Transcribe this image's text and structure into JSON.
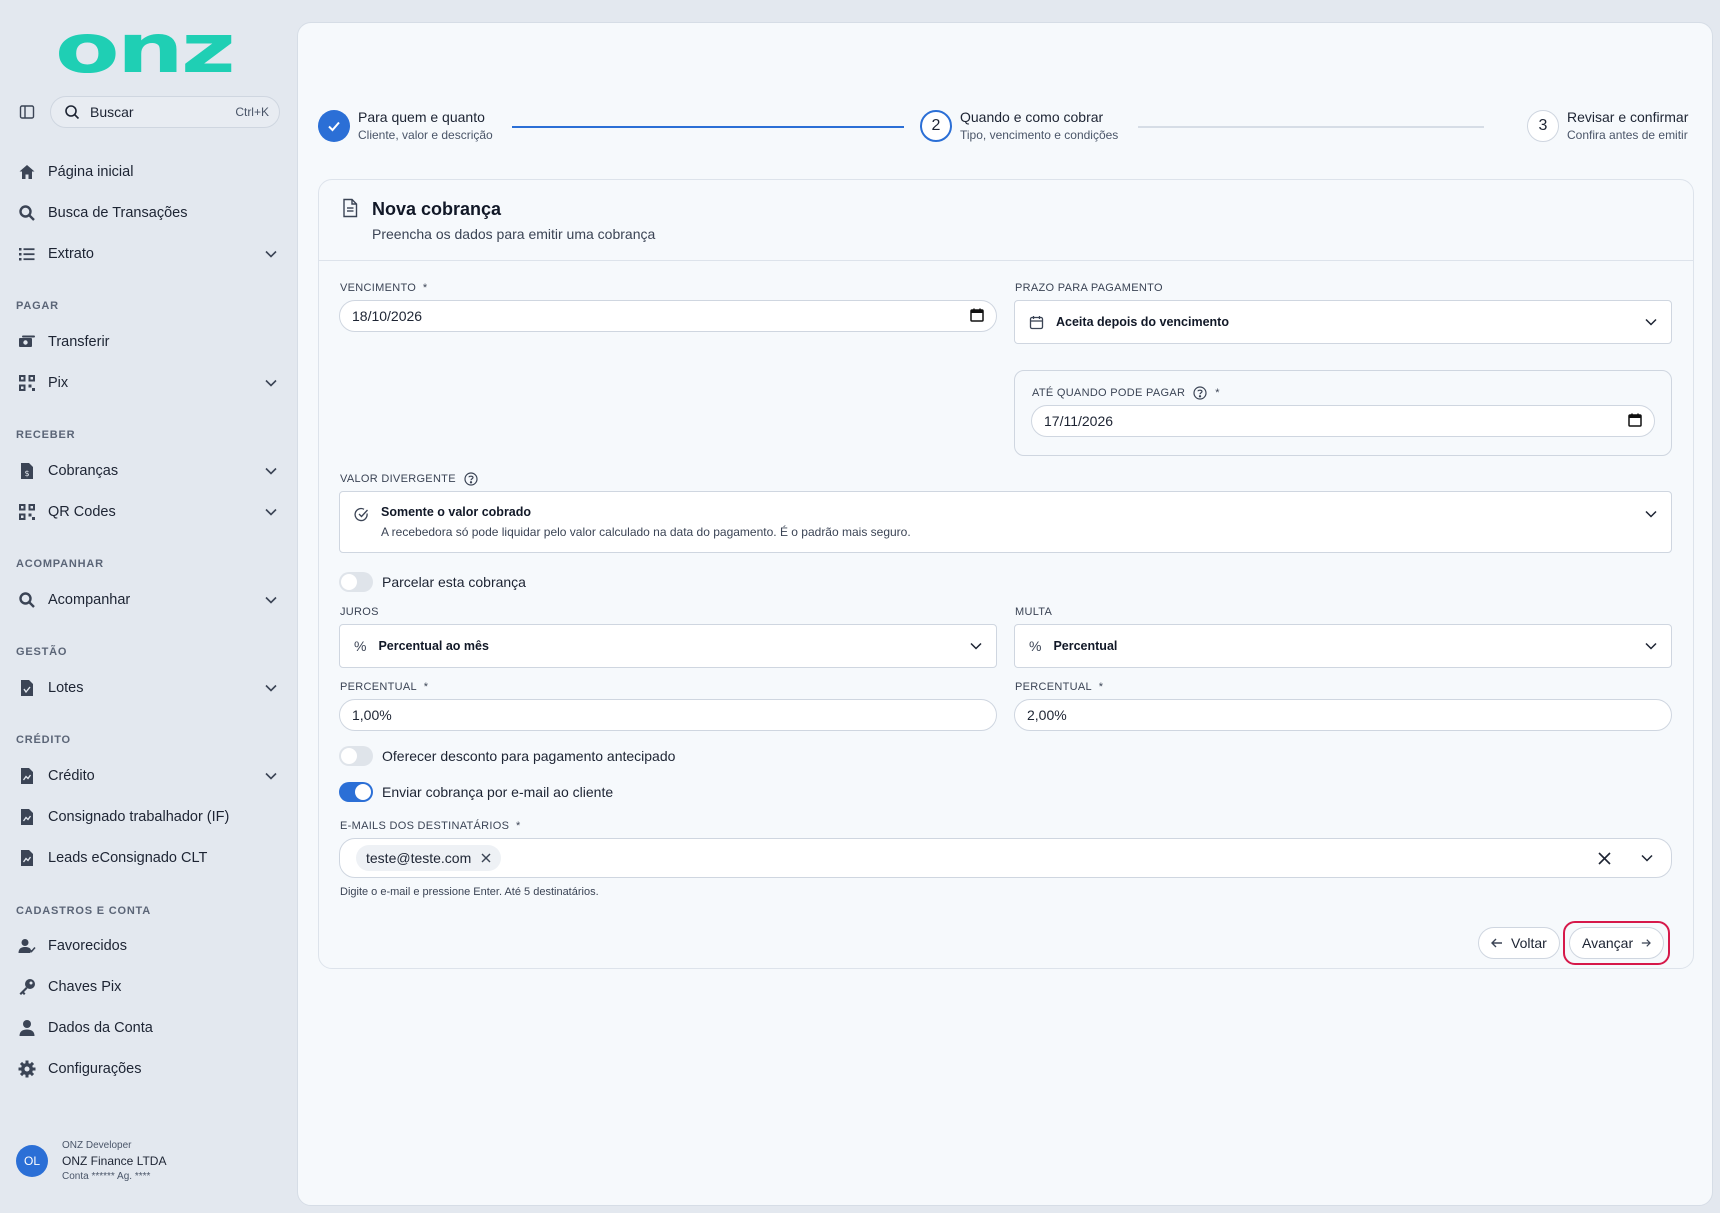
{
  "brand": {
    "logo_text": "onz",
    "accent": "#1fcfb4",
    "primary": "#2b6fd6"
  },
  "search": {
    "placeholder": "Buscar",
    "shortcut": "Ctrl+K"
  },
  "nav": {
    "top": [
      {
        "label": "Página inicial",
        "icon": "home-icon"
      },
      {
        "label": "Busca de Transações",
        "icon": "search-icon"
      },
      {
        "label": "Extrato",
        "icon": "list-icon",
        "expandable": true
      }
    ],
    "sections": [
      {
        "title": "PAGAR",
        "items": [
          {
            "label": "Transferir",
            "icon": "transfer-icon"
          },
          {
            "label": "Pix",
            "icon": "qr-icon",
            "expandable": true
          }
        ]
      },
      {
        "title": "RECEBER",
        "items": [
          {
            "label": "Cobranças",
            "icon": "invoice-icon",
            "expandable": true
          },
          {
            "label": "QR Codes",
            "icon": "qr-icon",
            "expandable": true
          }
        ]
      },
      {
        "title": "ACOMPANHAR",
        "items": [
          {
            "label": "Acompanhar",
            "icon": "search-icon",
            "expandable": true
          }
        ]
      },
      {
        "title": "GESTÃO",
        "items": [
          {
            "label": "Lotes",
            "icon": "file-icon",
            "expandable": true
          }
        ]
      },
      {
        "title": "CRÉDITO",
        "items": [
          {
            "label": "Crédito",
            "icon": "file-icon",
            "expandable": true
          },
          {
            "label": "Consignado trabalhador (IF)",
            "icon": "file-icon"
          },
          {
            "label": "Leads eConsignado CLT",
            "icon": "file-icon"
          }
        ]
      },
      {
        "title": "CADASTROS E CONTA",
        "items": [
          {
            "label": "Favorecidos",
            "icon": "user-check-icon"
          },
          {
            "label": "Chaves Pix",
            "icon": "key-icon"
          },
          {
            "label": "Dados da Conta",
            "icon": "user-icon"
          },
          {
            "label": "Configurações",
            "icon": "gear-icon"
          }
        ]
      }
    ]
  },
  "user": {
    "initials": "OL",
    "role": "ONZ Developer",
    "company": "ONZ Finance LTDA",
    "account": "Conta ****** Ag. ****"
  },
  "stepper": [
    {
      "title": "Para quem e quanto",
      "subtitle": "Cliente, valor e descrição",
      "state": "done"
    },
    {
      "number": "2",
      "title": "Quando e como cobrar",
      "subtitle": "Tipo, vencimento e condições",
      "state": "current"
    },
    {
      "number": "3",
      "title": "Revisar e confirmar",
      "subtitle": "Confira antes de emitir",
      "state": "pending"
    }
  ],
  "form": {
    "title": "Nova cobrança",
    "subtitle": "Preencha os dados para emitir uma cobrança",
    "vencimento": {
      "label": "VENCIMENTO",
      "required": "*",
      "value": "18/10/2026"
    },
    "prazo": {
      "label": "PRAZO PARA PAGAMENTO",
      "value": "Aceita depois do vencimento"
    },
    "ate_quando": {
      "label": "ATÉ QUANDO PODE PAGAR",
      "required": "*",
      "value": "17/11/2026"
    },
    "valor_divergente": {
      "label": "VALOR DIVERGENTE",
      "value": "Somente o valor cobrado",
      "description": "A recebedora só pode liquidar pelo valor calculado na data do pagamento. É o padrão mais seguro."
    },
    "parcelar": {
      "label": "Parcelar esta cobrança",
      "on": false
    },
    "juros": {
      "label": "JUROS",
      "value": "Percentual ao mês"
    },
    "multa": {
      "label": "MULTA",
      "value": "Percentual"
    },
    "juros_percentual": {
      "label": "PERCENTUAL",
      "required": "*",
      "value": "1,00%"
    },
    "multa_percentual": {
      "label": "PERCENTUAL",
      "required": "*",
      "value": "2,00%"
    },
    "desconto": {
      "label": "Oferecer desconto para pagamento antecipado",
      "on": false
    },
    "enviar_email": {
      "label": "Enviar cobrança por e-mail ao cliente",
      "on": true
    },
    "emails": {
      "label": "E-MAILS DOS DESTINATÁRIOS",
      "required": "*",
      "chips": [
        "teste@teste.com"
      ],
      "hint": "Digite o e-mail e pressione Enter. Até 5 destinatários."
    },
    "buttons": {
      "back": "Voltar",
      "next": "Avançar"
    }
  }
}
